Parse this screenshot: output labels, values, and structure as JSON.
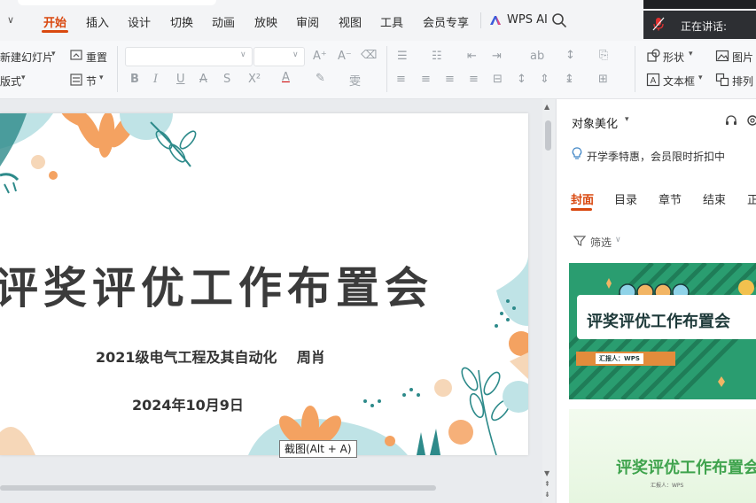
{
  "menu": {
    "tabs": [
      {
        "label": "开始",
        "active": true
      },
      {
        "label": "插入"
      },
      {
        "label": "设计"
      },
      {
        "label": "切换"
      },
      {
        "label": "动画"
      },
      {
        "label": "放映"
      },
      {
        "label": "审阅"
      },
      {
        "label": "视图"
      },
      {
        "label": "工具"
      },
      {
        "label": "会员专享"
      }
    ],
    "wps_ai": "WPS AI",
    "accent": "#d9480f"
  },
  "speaker": {
    "label": "正在讲话:"
  },
  "ribbon": {
    "new_slide": "新建幻灯片",
    "layout": "版式",
    "reset": "重置",
    "section": "节",
    "shape": "形状",
    "picture": "图片",
    "textbox": "文本框",
    "arrange": "排列"
  },
  "slide": {
    "title": "评奖评优工作布置会",
    "subtitle": "2021级电气工程及其自动化    周肖",
    "date": "2024年10月9日"
  },
  "tooltip": "截图(Alt + A)",
  "panel": {
    "title": "对象美化",
    "promo": "开学季特惠，会员限时折扣中",
    "tabs": [
      {
        "label": "封面",
        "active": true
      },
      {
        "label": "目录"
      },
      {
        "label": "章节"
      },
      {
        "label": "结束"
      },
      {
        "label": "正"
      }
    ],
    "filter": "筛选",
    "templates": [
      {
        "title": "评奖评优工作布置会",
        "author": "汇报人：WPS"
      },
      {
        "title": "评奖评优工作布置会",
        "author": "汇报人：WPS"
      }
    ]
  }
}
